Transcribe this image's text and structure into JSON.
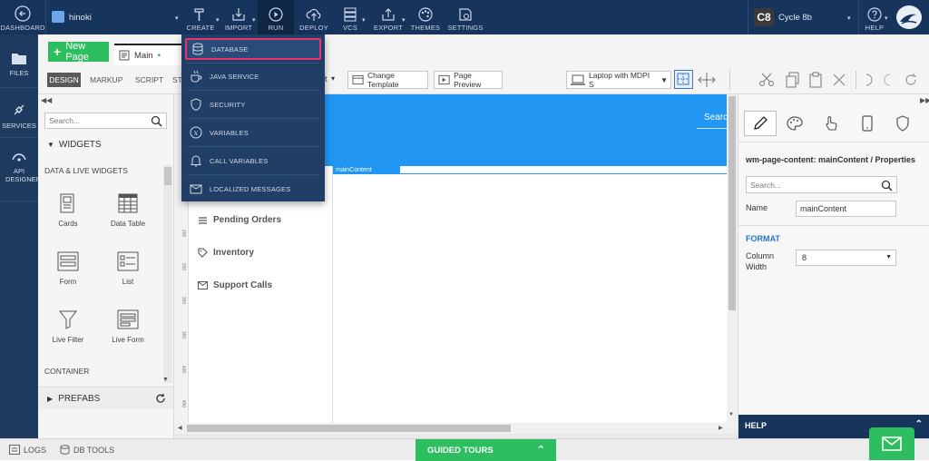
{
  "topbar": {
    "dashboard": "DASHBOARD",
    "project": "hinoki",
    "menu": [
      {
        "label": "CREATE"
      },
      {
        "label": "IMPORT"
      },
      {
        "label": "RUN"
      },
      {
        "label": "DEPLOY"
      },
      {
        "label": "VCS"
      },
      {
        "label": "EXPORT"
      },
      {
        "label": "THEMES"
      },
      {
        "label": "SETTINGS"
      }
    ],
    "avatar": "C8",
    "cycle": "Cycle 8b",
    "help": "HELP"
  },
  "leftnav": {
    "files": "FILES",
    "services": "SERVICES",
    "api": "API DESIGNER"
  },
  "pagebar": {
    "new_page": "New Page",
    "tab": "Main",
    "tab_marker": "•"
  },
  "toolbar": {
    "tabs": [
      "DESIGN",
      "MARKUP",
      "SCRIPT",
      "ST"
    ],
    "select_tail": "t",
    "change_template": "Change Template",
    "page_preview": "Page Preview",
    "device": "Laptop with MDPI S"
  },
  "widgets": {
    "search_placeholder": "Search...",
    "header": "WIDGETS",
    "section": "DATA & LIVE WIDGETS",
    "items": [
      {
        "label": "Cards",
        "icon": "cards-icon"
      },
      {
        "label": "Data Table",
        "icon": "data-table-icon"
      },
      {
        "label": "Form",
        "icon": "form-icon"
      },
      {
        "label": "List",
        "icon": "list-icon"
      },
      {
        "label": "Live Filter",
        "icon": "filter-icon"
      },
      {
        "label": "Live Form",
        "icon": "live-form-icon"
      }
    ],
    "container": "CONTAINER",
    "prefabs": "PREFABS"
  },
  "canvas": {
    "search": "Searc",
    "main_content_label": "mainContent",
    "nav_items": [
      {
        "label": "Pending Orders",
        "icon": "list-icon"
      },
      {
        "label": "Inventory",
        "icon": "tag-icon"
      },
      {
        "label": "Support Calls",
        "icon": "mail-icon"
      }
    ],
    "ruler_marks": [
      "200",
      "250",
      "300",
      "350",
      "400",
      "450"
    ]
  },
  "dropdown": {
    "items": [
      {
        "label": "DATABASE",
        "icon": "database-icon"
      },
      {
        "label": "JAVA SERVICE",
        "icon": "coffee-icon"
      },
      {
        "label": "SECURITY",
        "icon": "shield-icon"
      },
      {
        "label": "VARIABLES",
        "icon": "variable-icon"
      },
      {
        "label": "CALL VARIABLES",
        "icon": "bell-icon"
      },
      {
        "label": "LOCALIZED MESSAGES",
        "icon": "message-icon"
      }
    ],
    "highlight_color": "#e8336d"
  },
  "props": {
    "title": "wm-page-content: mainContent / Properties",
    "search_placeholder": "Search...",
    "name_label": "Name",
    "name_value": "mainContent",
    "format": "FORMAT",
    "column_label_1": "Column",
    "column_label_2": "Width",
    "column_value": "8",
    "help": "HELP"
  },
  "bottombar": {
    "logs": "LOGS",
    "db_tools": "DB TOOLS",
    "guided_tours": "GUIDED TOURS"
  },
  "colors": {
    "topbar": "#17345c",
    "accent_blue": "#2196f3",
    "green": "#2dbe60"
  }
}
